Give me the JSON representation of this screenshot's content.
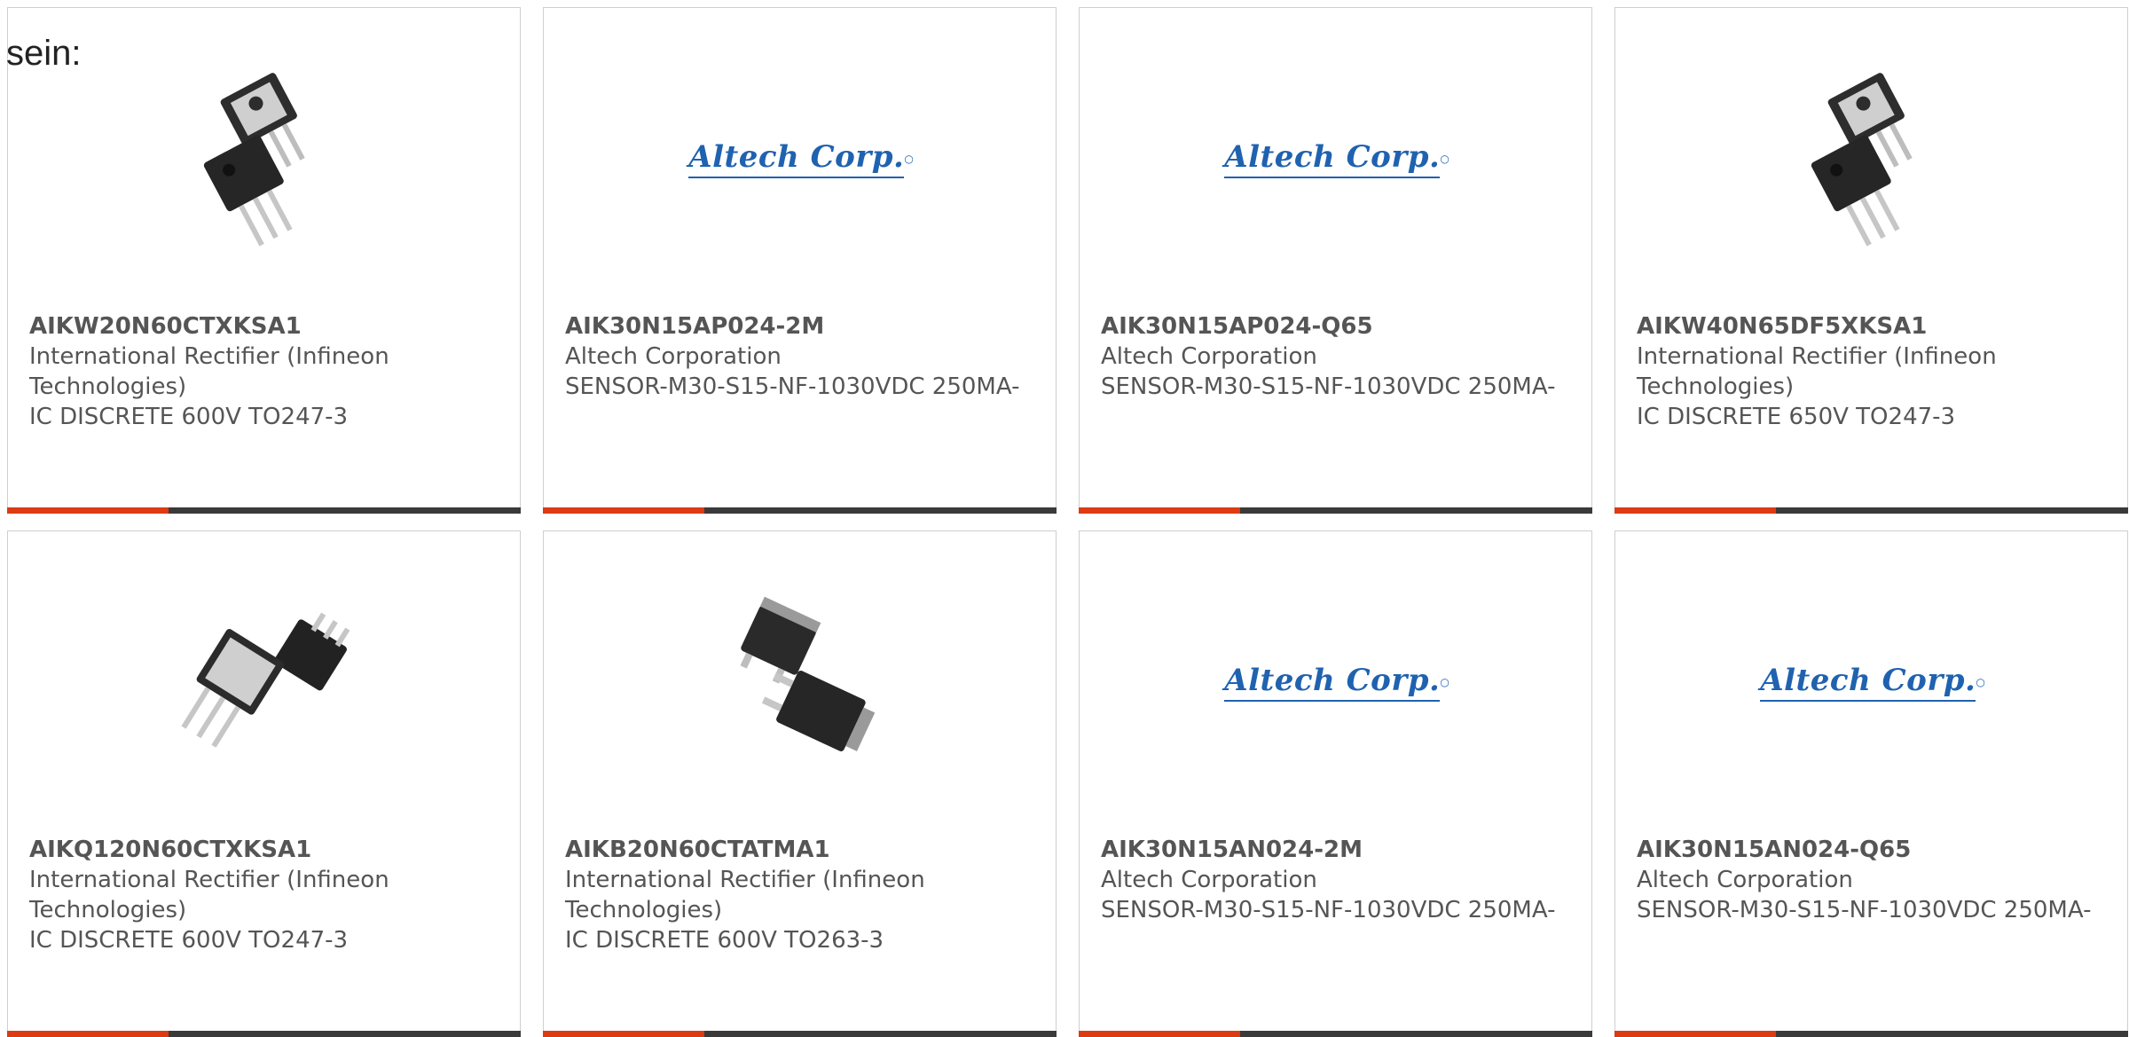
{
  "intro_text": "sein:",
  "colors": {
    "accent": "#dc3b14",
    "bar": "#3a3a3a",
    "logo_blue": "#1f62b0",
    "text": "#555555"
  },
  "logo_text": "Altech Corp.",
  "products": [
    {
      "part_number": "AIKW20N60CTXKSA1",
      "manufacturer": "International Rectifier (Infineon Technologies)",
      "description": "IC DISCRETE 600V TO247-3",
      "image": "to247-package-icon"
    },
    {
      "part_number": "AIK30N15AP024-2M",
      "manufacturer": "Altech Corporation",
      "description": "SENSOR-M30-S15-NF-1030VDC 250MA-",
      "image": "altech-logo"
    },
    {
      "part_number": "AIK30N15AP024-Q65",
      "manufacturer": "Altech Corporation",
      "description": "SENSOR-M30-S15-NF-1030VDC 250MA-",
      "image": "altech-logo"
    },
    {
      "part_number": "AIKW40N65DF5XKSA1",
      "manufacturer": "International Rectifier (Infineon Technologies)",
      "description": "IC DISCRETE 650V TO247-3",
      "image": "to247-package-icon"
    },
    {
      "part_number": "AIKQ120N60CTXKSA1",
      "manufacturer": "International Rectifier (Infineon Technologies)",
      "description": "IC DISCRETE 600V TO247-3",
      "image": "to247-package-icon"
    },
    {
      "part_number": "AIKB20N60CTATMA1",
      "manufacturer": "International Rectifier (Infineon Technologies)",
      "description": "IC DISCRETE 600V TO263-3",
      "image": "to263-package-icon"
    },
    {
      "part_number": "AIK30N15AN024-2M",
      "manufacturer": "Altech Corporation",
      "description": "SENSOR-M30-S15-NF-1030VDC 250MA-",
      "image": "altech-logo"
    },
    {
      "part_number": "AIK30N15AN024-Q65",
      "manufacturer": "Altech Corporation",
      "description": "SENSOR-M30-S15-NF-1030VDC 250MA-",
      "image": "altech-logo"
    }
  ]
}
